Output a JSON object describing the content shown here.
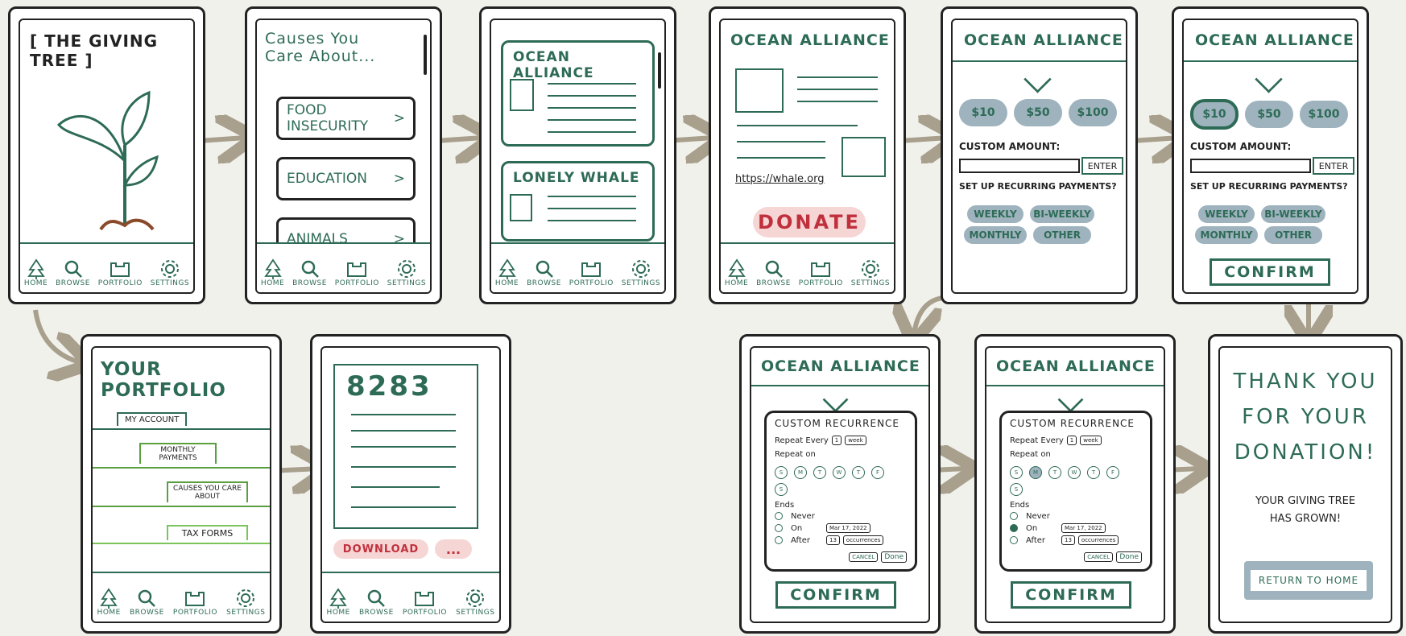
{
  "nav": {
    "home": "HOME",
    "browse": "BROWSE",
    "portfolio": "PORTFOLIO",
    "settings": "SETTINGS"
  },
  "screen1": {
    "title": "[ THE GIVING TREE ]"
  },
  "screen2": {
    "title": "Causes You Care About...",
    "items": [
      "FOOD INSECURITY",
      "EDUCATION",
      "ANIMALS"
    ],
    "chevron": ">"
  },
  "screen3": {
    "cards": [
      "OCEAN ALLIANCE",
      "LONELY WHALE"
    ]
  },
  "screen4": {
    "title": "OCEAN ALLIANCE",
    "url": "https://whale.org",
    "donate": "DONATE"
  },
  "donation": {
    "title": "OCEAN ALLIANCE",
    "amounts": [
      "$10",
      "$50",
      "$100"
    ],
    "custom_label": "CUSTOM AMOUNT:",
    "enter": "ENTER",
    "recurring_label": "SET UP RECURRING PAYMENTS?",
    "frequencies": [
      "WEEKLY",
      "BI-WEEKLY",
      "MONTHLY",
      "OTHER"
    ],
    "confirm": "CONFIRM"
  },
  "recurrence": {
    "title": "CUSTOM RECURRENCE",
    "repeat_every": "Repeat Every",
    "count": "1",
    "unit": "week",
    "repeat_on": "Repeat on",
    "days": [
      "S",
      "M",
      "T",
      "W",
      "T",
      "F",
      "S"
    ],
    "ends": "Ends",
    "never": "Never",
    "on": "On",
    "date": "Mar 17, 2022",
    "after": "After",
    "occurrences_count": "13",
    "occurrences": "occurrences",
    "cancel": "CANCEL",
    "done": "Done"
  },
  "thanks": {
    "line1": "THANK YOU",
    "line2": "FOR YOUR",
    "line3": "DONATION!",
    "sub1": "YOUR GIVING TREE",
    "sub2": "HAS GROWN!",
    "button": "RETURN TO HOME"
  },
  "portfolio": {
    "title": "YOUR PORTFOLIO",
    "tabs": [
      "MY ACCOUNT",
      "MONTHLY PAYMENTS",
      "CAUSES YOU CARE ABOUT",
      "TAX FORMS"
    ]
  },
  "taxform": {
    "number": "8283",
    "download": "DOWNLOAD",
    "more": "..."
  },
  "colors": {
    "green": "#2e6b57",
    "pill": "#9eb3bd",
    "pink": "#f6d5d5",
    "red": "#c0303c",
    "arrow": "#a89f8c",
    "background": "#f1f1ec"
  }
}
